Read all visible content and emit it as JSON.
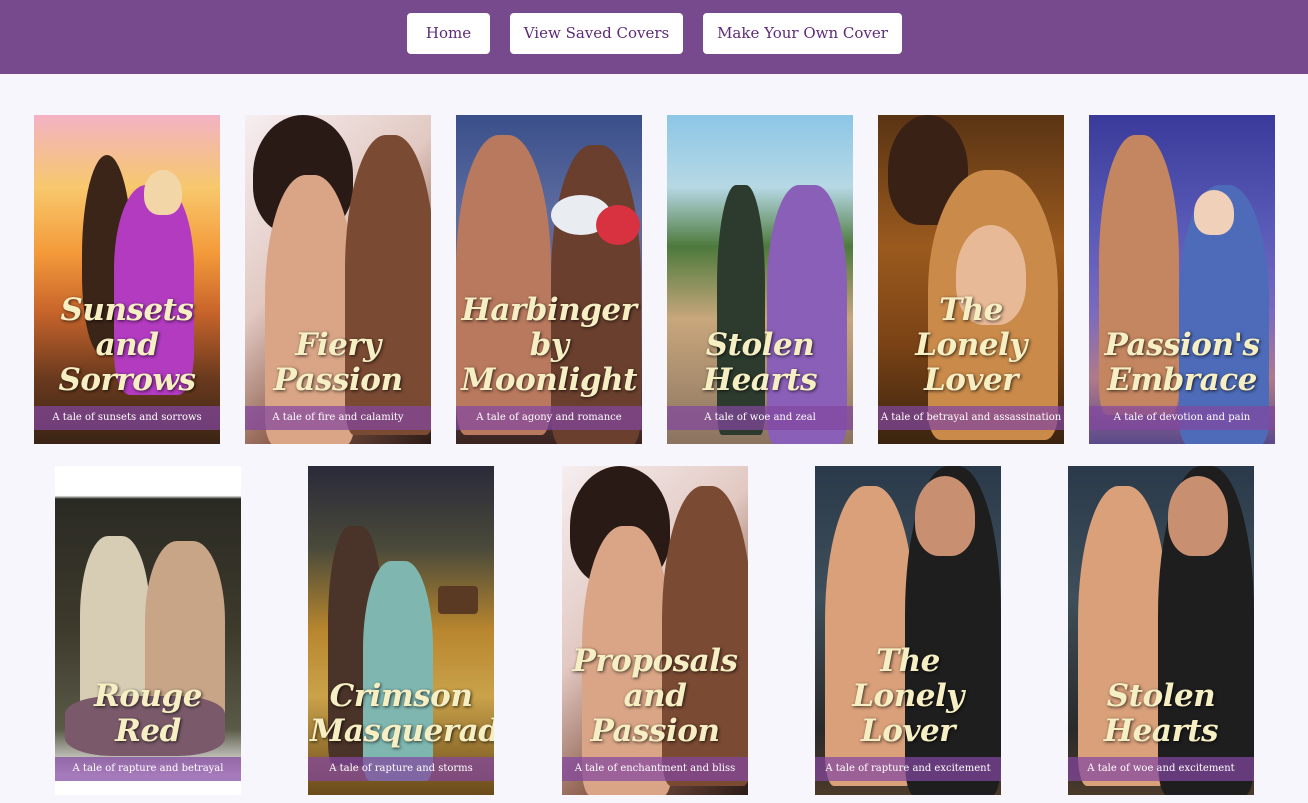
{
  "nav": {
    "home_label": "Home",
    "saved_label": "View Saved Covers",
    "make_label": "Make Your Own Cover"
  },
  "colors": {
    "header": "#774a8d",
    "page_background": "#f7f6fd",
    "button_text": "#5e2a78",
    "title_text": "#f7efc4",
    "tagline_band": "#8246a0"
  },
  "covers": [
    {
      "title": "Sunsets and Sorrows",
      "tagline": "A tale of sunsets and sorrows"
    },
    {
      "title": "Fiery Passion",
      "tagline": "A tale of fire and calamity"
    },
    {
      "title": "Harbinger by Moonlight",
      "tagline": "A tale of agony and romance"
    },
    {
      "title": "Stolen Hearts",
      "tagline": "A tale of woe and zeal"
    },
    {
      "title": "The Lonely Lover",
      "tagline": "A tale of betrayal and assassination"
    },
    {
      "title": "Passion's Embrace",
      "tagline": "A tale of devotion and pain"
    },
    {
      "title": "Rouge Red",
      "tagline": "A tale of rapture and betrayal"
    },
    {
      "title": "Crimson Masquerade",
      "tagline": "A tale of rapture and storms"
    },
    {
      "title": "Proposals and Passion",
      "tagline": "A tale of enchantment and bliss"
    },
    {
      "title": "The Lonely Lover",
      "tagline": "A tale of rapture and excitement"
    },
    {
      "title": "Stolen Hearts",
      "tagline": "A tale of woe and excitement"
    }
  ]
}
